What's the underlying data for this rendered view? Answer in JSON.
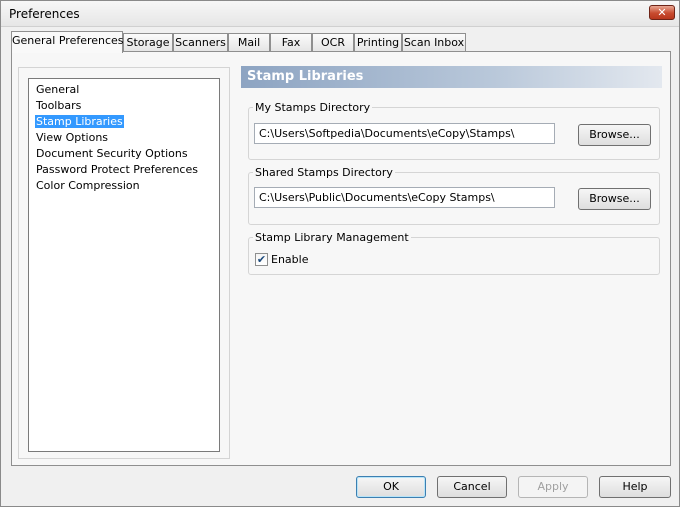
{
  "window": {
    "title": "Preferences",
    "close_glyph": "✕"
  },
  "tabs": [
    {
      "label": "General Preferences"
    },
    {
      "label": "Storage"
    },
    {
      "label": "Scanners"
    },
    {
      "label": "Mail"
    },
    {
      "label": "Fax"
    },
    {
      "label": "OCR"
    },
    {
      "label": "Printing"
    },
    {
      "label": "Scan Inbox"
    }
  ],
  "sidebar": {
    "items": [
      {
        "label": "General"
      },
      {
        "label": "Toolbars"
      },
      {
        "label": "Stamp Libraries"
      },
      {
        "label": "View Options"
      },
      {
        "label": "Document Security Options"
      },
      {
        "label": "Password Protect Preferences"
      },
      {
        "label": "Color Compression"
      }
    ],
    "selected": "Stamp Libraries"
  },
  "main": {
    "header": "Stamp Libraries",
    "my_stamps": {
      "label": "My Stamps Directory",
      "path": "C:\\Users\\Softpedia\\Documents\\eCopy\\Stamps\\",
      "browse_label": "Browse..."
    },
    "shared_stamps": {
      "label": "Shared Stamps Directory",
      "path": "C:\\Users\\Public\\Documents\\eCopy Stamps\\",
      "browse_label": "Browse..."
    },
    "management": {
      "label": "Stamp Library Management",
      "enable_label": "Enable",
      "enable_checked": true,
      "check_glyph": "✔"
    }
  },
  "footer": {
    "ok_label": "OK",
    "cancel_label": "Cancel",
    "apply_label": "Apply",
    "help_label": "Help"
  }
}
